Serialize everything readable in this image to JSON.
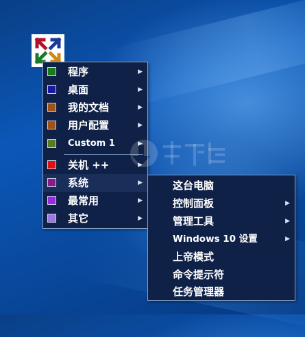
{
  "colors": {
    "desktop_blue": "#0b57b8",
    "menu_bg": "#0f2147",
    "menu_border": "#8fa6c9",
    "highlight_bg": "#1a2e5a",
    "text": "#ffffff"
  },
  "app_icon": {
    "icon": "four-arrows-logo-icon"
  },
  "main_menu": {
    "items": [
      {
        "label": "程序",
        "swatch": "#1a7a1a",
        "submenu": true
      },
      {
        "label": "桌面",
        "swatch": "#1a1aa0",
        "submenu": true
      },
      {
        "label": "我的文档",
        "swatch": "#a0521a",
        "submenu": true
      },
      {
        "label": "用户配置",
        "swatch": "#a0521a",
        "submenu": true
      },
      {
        "label": "Custom 1",
        "swatch": "#5a7a2a",
        "submenu": true
      },
      {
        "label": "关机 ++",
        "swatch": "#e01010",
        "submenu": true
      },
      {
        "label": "系统",
        "swatch": "#8a1a8a",
        "submenu": true,
        "highlighted": true
      },
      {
        "label": "最常用",
        "swatch": "#9a2ae0",
        "submenu": true
      },
      {
        "label": "其它",
        "swatch": "#9a7ae0",
        "submenu": true
      }
    ]
  },
  "sub_menu": {
    "items": [
      {
        "label": "这台电脑",
        "submenu": false
      },
      {
        "label": "控制面板",
        "submenu": true
      },
      {
        "label": "管理工具",
        "submenu": true
      },
      {
        "label": "Windows 10 设置",
        "submenu": true
      },
      {
        "label": "上帝模式",
        "submenu": false
      },
      {
        "label": "命令提示符",
        "submenu": false
      },
      {
        "label": "任务管理器",
        "submenu": false
      }
    ]
  },
  "arrow_glyph": "▶"
}
